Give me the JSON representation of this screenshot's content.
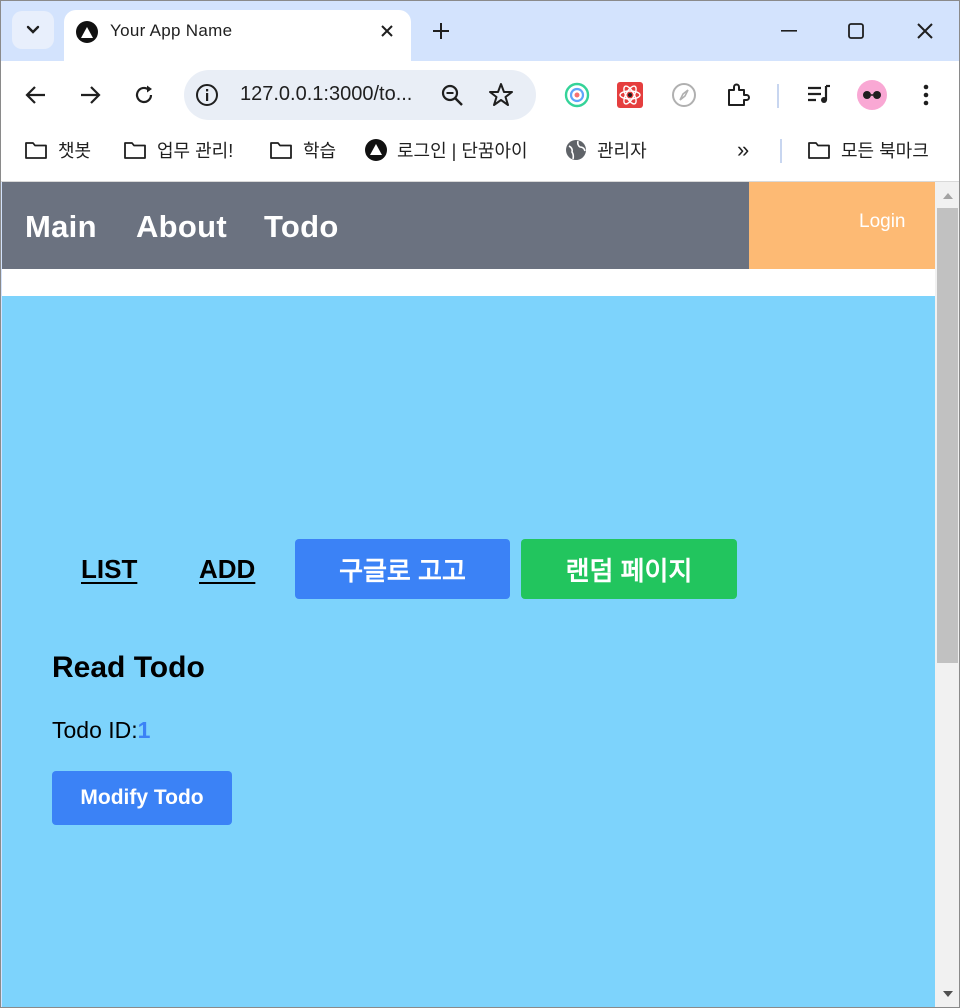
{
  "browser": {
    "tab_title": "Your App Name",
    "url": "127.0.0.1:3000/to...",
    "bookmarks": [
      "챗봇",
      "업무 관리!",
      "학습",
      "로그인 | 단꿈아이",
      "관리자"
    ],
    "bookmarks_overflow": "»",
    "all_bookmarks": "모든 북마크"
  },
  "nav": {
    "links": [
      "Main",
      "About",
      "Todo"
    ],
    "login": "Login"
  },
  "subnav": {
    "list": "LIST",
    "add": "ADD",
    "google_button": "구글로 고고",
    "random_button": "랜덤 페이지"
  },
  "read": {
    "title": "Read Todo",
    "id_label": "Todo ID:",
    "id_value": "1",
    "modify_button": "Modify Todo"
  },
  "colors": {
    "nav_bg": "#6b7280",
    "login_bg": "#fdba74",
    "content_bg": "#7dd3fc",
    "primary_button": "#3b82f6",
    "random_button": "#22c55e"
  }
}
